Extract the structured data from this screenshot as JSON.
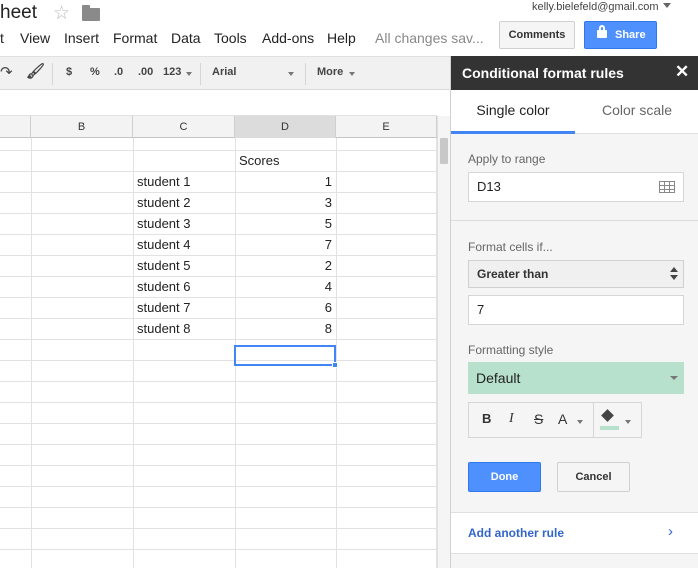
{
  "app": {
    "doc_title": "heet",
    "account_email": "kelly.bielefeld@gmail.com",
    "save_status": "All changes sav..."
  },
  "menu": [
    "t",
    "View",
    "Insert",
    "Format",
    "Data",
    "Tools",
    "Add-ons",
    "Help"
  ],
  "header_buttons": {
    "comments": "Comments",
    "share": "Share"
  },
  "toolbar": {
    "currency": "$",
    "percent": "%",
    "decrease_decimals": ".0",
    "increase_decimals": ".00",
    "more_formats": "123",
    "font": "Arial",
    "more": "More"
  },
  "columns": [
    "B",
    "C",
    "D",
    "E"
  ],
  "sheet": {
    "header_label": "Scores",
    "rows": [
      {
        "name": "student 1",
        "score": "1"
      },
      {
        "name": "student 2",
        "score": "3"
      },
      {
        "name": "student 3",
        "score": "5"
      },
      {
        "name": "student 4",
        "score": "7"
      },
      {
        "name": "student 5",
        "score": "2"
      },
      {
        "name": "student 6",
        "score": "4"
      },
      {
        "name": "student 7",
        "score": "6"
      },
      {
        "name": "student 8",
        "score": "8"
      }
    ]
  },
  "panel": {
    "title": "Conditional format rules",
    "close": "✕",
    "tabs": [
      "Single color",
      "Color scale"
    ],
    "range_label": "Apply to range",
    "range_value": "D13",
    "condition_label": "Format cells if...",
    "condition_value": "Greater than",
    "condition_input": "7",
    "style_label": "Formatting style",
    "style_value": "Default",
    "style_color": "#b7e1cd",
    "style_buttons": {
      "bold": "B",
      "italic": "I",
      "strike": "S",
      "text_color": "A"
    },
    "done": "Done",
    "cancel": "Cancel",
    "add_rule": "Add another rule",
    "add_rule_chevron": "›"
  },
  "colors": {
    "accent": "#4285f4",
    "button_blue": "#4d90fe",
    "panel_header": "#333333"
  }
}
